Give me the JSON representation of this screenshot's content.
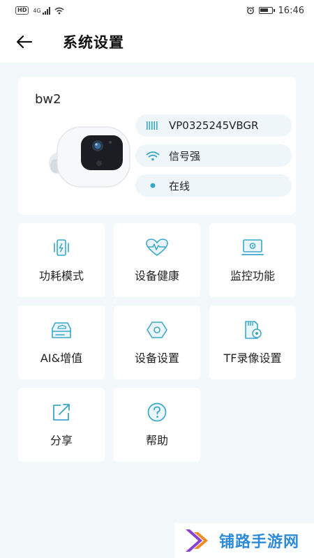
{
  "status_bar": {
    "network_badge": "HD",
    "network_type": "4G",
    "time": "16:46"
  },
  "header": {
    "title": "系统设置"
  },
  "device": {
    "name": "bw2",
    "serial": "VP0325245VBGR",
    "signal_text": "信号强",
    "status_text": "在线"
  },
  "tiles": [
    {
      "label": "功耗模式",
      "icon": "power-mode-icon"
    },
    {
      "label": "设备健康",
      "icon": "heart-rate-icon"
    },
    {
      "label": "监控功能",
      "icon": "monitor-icon"
    },
    {
      "label": "AI&增值",
      "icon": "cloud-storage-icon"
    },
    {
      "label": "设备设置",
      "icon": "hexagon-settings-icon"
    },
    {
      "label": "TF录像设置",
      "icon": "sd-card-icon"
    },
    {
      "label": "分享",
      "icon": "share-icon"
    },
    {
      "label": "帮助",
      "icon": "help-icon"
    }
  ],
  "watermark": {
    "text": "铺路手游网"
  },
  "colors": {
    "accent": "#3aa7c9",
    "background": "#f3f8fb",
    "pill_background": "#eef6fa"
  }
}
